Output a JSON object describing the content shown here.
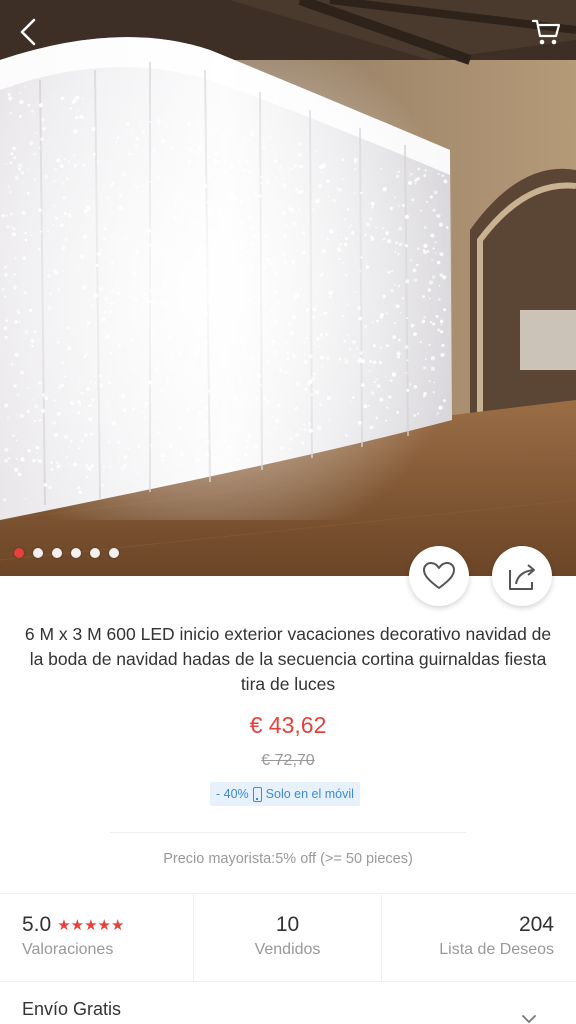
{
  "header": {
    "back_icon": "chevron-left-icon",
    "cart_icon": "cart-icon"
  },
  "gallery": {
    "image_count": 6,
    "active_index": 0,
    "colors": {
      "active_dot": "#e8403a",
      "inactive_dot": "#ffffff"
    }
  },
  "actions": {
    "wishlist_icon": "heart-icon",
    "share_icon": "share-icon"
  },
  "product": {
    "title": "6 M x 3 M 600 LED inicio exterior vacaciones decorativo navidad de la boda de navidad hadas de la secuencia cortina guirnaldas fiesta tira de luces",
    "price": "€ 43,62",
    "old_price": "€ 72,70",
    "discount": "- 40%",
    "mobile_only": "Solo en el móvil",
    "wholesale": "Precio mayorista:5% off (>= 50 pieces)"
  },
  "stats": {
    "rating": {
      "value": "5.0",
      "stars": "★★★★★",
      "label": "Valoraciones",
      "star_count": 5
    },
    "sold": {
      "value": "10",
      "label": "Vendidos"
    },
    "wishlist": {
      "value": "204",
      "label": "Lista de Deseos"
    }
  },
  "shipping": {
    "label": "Envío Gratis",
    "chevron_icon": "chevron-down-icon"
  },
  "theme": {
    "accent": "#e8403a",
    "muted": "#999999",
    "promo_bg": "#e6f1fb",
    "promo_text": "#3f8ad6"
  }
}
